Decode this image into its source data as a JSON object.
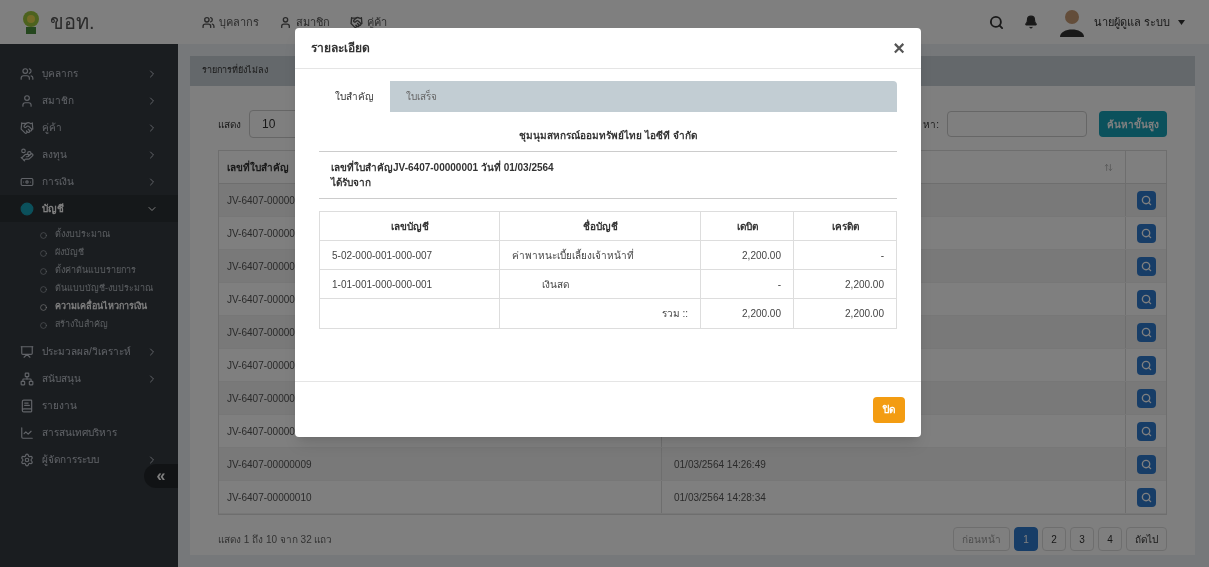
{
  "header": {
    "brand": "ขอท.",
    "nav": [
      {
        "label": "บุคลากร"
      },
      {
        "label": "สมาชิก"
      },
      {
        "label": "คู่ค้า"
      }
    ],
    "user": "นายผู้ดูแล ระบบ"
  },
  "sidebar": {
    "items": [
      {
        "label": "บุคลากร",
        "has_submenu": true,
        "expanded": false
      },
      {
        "label": "สมาชิก",
        "has_submenu": true,
        "expanded": false
      },
      {
        "label": "คู่ค้า",
        "has_submenu": true,
        "expanded": false
      },
      {
        "label": "ลงทุน",
        "has_submenu": true,
        "expanded": false
      },
      {
        "label": "การเงิน",
        "has_submenu": true,
        "expanded": false
      },
      {
        "label": "บัญชี",
        "has_submenu": true,
        "expanded": true,
        "children": [
          {
            "label": "ตั้งงบประมาณ",
            "selected": false
          },
          {
            "label": "ผังบัญชี",
            "selected": false
          },
          {
            "label": "ตั้งค่าต้นแบบรายการ",
            "selected": false
          },
          {
            "label": "ต้นแบบบัญชี-งบประมาณ",
            "selected": false
          },
          {
            "label": "ความเคลื่อนไหวการเงิน",
            "selected": true
          },
          {
            "label": "สร้างใบสำคัญ",
            "selected": false
          }
        ]
      },
      {
        "label": "ประมวลผล/วิเคราะห์",
        "has_submenu": true,
        "expanded": false
      },
      {
        "label": "สนับสนุน",
        "has_submenu": true,
        "expanded": false
      },
      {
        "label": "รายงาน",
        "has_submenu": false,
        "expanded": false
      },
      {
        "label": "สารสนเทศบริหาร",
        "has_submenu": false,
        "expanded": false
      },
      {
        "label": "ผู้จัดการระบบ",
        "has_submenu": true,
        "expanded": false
      }
    ],
    "collapse": "«"
  },
  "panel": {
    "title": "รายการที่ยังไม่ลง",
    "show_label": "แสดง",
    "page_size": "10",
    "search_label": "หา:",
    "advanced_search": "ค้นหาขั้นสูง",
    "table": {
      "columns": [
        "เลขที่ใบสำคัญ"
      ],
      "rows": [
        {
          "id": "JV-6407-00000"
        },
        {
          "id": "JV-6407-00000"
        },
        {
          "id": "JV-6407-00000"
        },
        {
          "id": "JV-6407-00000"
        },
        {
          "id": "JV-6407-00000"
        },
        {
          "id": "JV-6407-00000"
        },
        {
          "id": "JV-6407-00000"
        },
        {
          "id": "JV-6407-00000"
        },
        {
          "id": "JV-6407-00000009",
          "date": "01/03/2564 14:26:49"
        },
        {
          "id": "JV-6407-00000010",
          "date": "01/03/2564 14:28:34"
        }
      ]
    },
    "summary": "แสดง 1 ถึง 10 จาก 32 แถว",
    "pagination": {
      "prev": "ก่อนหน้า",
      "next": "ถัดไป",
      "pages": [
        {
          "label": "1",
          "selected": true
        },
        {
          "label": "2",
          "selected": false
        },
        {
          "label": "3",
          "selected": false
        },
        {
          "label": "4",
          "selected": false
        }
      ]
    }
  },
  "modal": {
    "title": "รายละเอียด",
    "close": "×",
    "tabs": [
      {
        "label": "ใบสำคัญ",
        "selected": true
      },
      {
        "label": "ใบเสร็จ",
        "selected": false
      }
    ],
    "company": "ชุมนุมสหกรณ์ออมทรัพย์ไทย ไอซีที จำกัด",
    "voucher": "เลขที่ใบสำคัญJV-6407-00000001 วันที่ 01/03/2564",
    "received_from": "ได้รับจาก",
    "table": {
      "columns": [
        "เลขบัญชี",
        "ชื่อบัญชี",
        "เดบิต",
        "เครดิต"
      ],
      "rows": [
        {
          "account_no": "5-02-000-001-000-007",
          "account_name": "ค่าพาหนะเบี้ยเลี้ยงเจ้าหน้าที่",
          "indent": false,
          "debit": "2,200.00",
          "credit": "-"
        },
        {
          "account_no": "1-01-001-000-000-001",
          "account_name": "เงินสด",
          "indent": true,
          "debit": "-",
          "credit": "2,200.00"
        }
      ],
      "total": {
        "label": "รวม ::",
        "debit": "2,200.00",
        "credit": "2,200.00"
      }
    },
    "close_button": "ปิด"
  }
}
